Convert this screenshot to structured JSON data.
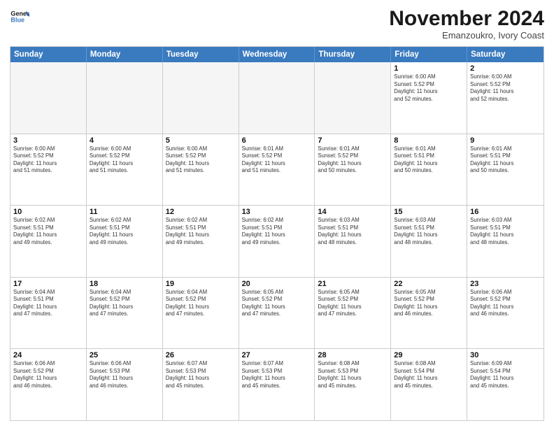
{
  "logo": {
    "line1": "General",
    "line2": "Blue"
  },
  "title": "November 2024",
  "location": "Emanzoukro, Ivory Coast",
  "header": {
    "days": [
      "Sunday",
      "Monday",
      "Tuesday",
      "Wednesday",
      "Thursday",
      "Friday",
      "Saturday"
    ]
  },
  "weeks": [
    [
      {
        "day": "",
        "info": ""
      },
      {
        "day": "",
        "info": ""
      },
      {
        "day": "",
        "info": ""
      },
      {
        "day": "",
        "info": ""
      },
      {
        "day": "",
        "info": ""
      },
      {
        "day": "1",
        "info": "Sunrise: 6:00 AM\nSunset: 5:52 PM\nDaylight: 11 hours\nand 52 minutes."
      },
      {
        "day": "2",
        "info": "Sunrise: 6:00 AM\nSunset: 5:52 PM\nDaylight: 11 hours\nand 52 minutes."
      }
    ],
    [
      {
        "day": "3",
        "info": "Sunrise: 6:00 AM\nSunset: 5:52 PM\nDaylight: 11 hours\nand 51 minutes."
      },
      {
        "day": "4",
        "info": "Sunrise: 6:00 AM\nSunset: 5:52 PM\nDaylight: 11 hours\nand 51 minutes."
      },
      {
        "day": "5",
        "info": "Sunrise: 6:00 AM\nSunset: 5:52 PM\nDaylight: 11 hours\nand 51 minutes."
      },
      {
        "day": "6",
        "info": "Sunrise: 6:01 AM\nSunset: 5:52 PM\nDaylight: 11 hours\nand 51 minutes."
      },
      {
        "day": "7",
        "info": "Sunrise: 6:01 AM\nSunset: 5:52 PM\nDaylight: 11 hours\nand 50 minutes."
      },
      {
        "day": "8",
        "info": "Sunrise: 6:01 AM\nSunset: 5:51 PM\nDaylight: 11 hours\nand 50 minutes."
      },
      {
        "day": "9",
        "info": "Sunrise: 6:01 AM\nSunset: 5:51 PM\nDaylight: 11 hours\nand 50 minutes."
      }
    ],
    [
      {
        "day": "10",
        "info": "Sunrise: 6:02 AM\nSunset: 5:51 PM\nDaylight: 11 hours\nand 49 minutes."
      },
      {
        "day": "11",
        "info": "Sunrise: 6:02 AM\nSunset: 5:51 PM\nDaylight: 11 hours\nand 49 minutes."
      },
      {
        "day": "12",
        "info": "Sunrise: 6:02 AM\nSunset: 5:51 PM\nDaylight: 11 hours\nand 49 minutes."
      },
      {
        "day": "13",
        "info": "Sunrise: 6:02 AM\nSunset: 5:51 PM\nDaylight: 11 hours\nand 49 minutes."
      },
      {
        "day": "14",
        "info": "Sunrise: 6:03 AM\nSunset: 5:51 PM\nDaylight: 11 hours\nand 48 minutes."
      },
      {
        "day": "15",
        "info": "Sunrise: 6:03 AM\nSunset: 5:51 PM\nDaylight: 11 hours\nand 48 minutes."
      },
      {
        "day": "16",
        "info": "Sunrise: 6:03 AM\nSunset: 5:51 PM\nDaylight: 11 hours\nand 48 minutes."
      }
    ],
    [
      {
        "day": "17",
        "info": "Sunrise: 6:04 AM\nSunset: 5:51 PM\nDaylight: 11 hours\nand 47 minutes."
      },
      {
        "day": "18",
        "info": "Sunrise: 6:04 AM\nSunset: 5:52 PM\nDaylight: 11 hours\nand 47 minutes."
      },
      {
        "day": "19",
        "info": "Sunrise: 6:04 AM\nSunset: 5:52 PM\nDaylight: 11 hours\nand 47 minutes."
      },
      {
        "day": "20",
        "info": "Sunrise: 6:05 AM\nSunset: 5:52 PM\nDaylight: 11 hours\nand 47 minutes."
      },
      {
        "day": "21",
        "info": "Sunrise: 6:05 AM\nSunset: 5:52 PM\nDaylight: 11 hours\nand 47 minutes."
      },
      {
        "day": "22",
        "info": "Sunrise: 6:05 AM\nSunset: 5:52 PM\nDaylight: 11 hours\nand 46 minutes."
      },
      {
        "day": "23",
        "info": "Sunrise: 6:06 AM\nSunset: 5:52 PM\nDaylight: 11 hours\nand 46 minutes."
      }
    ],
    [
      {
        "day": "24",
        "info": "Sunrise: 6:06 AM\nSunset: 5:52 PM\nDaylight: 11 hours\nand 46 minutes."
      },
      {
        "day": "25",
        "info": "Sunrise: 6:06 AM\nSunset: 5:53 PM\nDaylight: 11 hours\nand 46 minutes."
      },
      {
        "day": "26",
        "info": "Sunrise: 6:07 AM\nSunset: 5:53 PM\nDaylight: 11 hours\nand 45 minutes."
      },
      {
        "day": "27",
        "info": "Sunrise: 6:07 AM\nSunset: 5:53 PM\nDaylight: 11 hours\nand 45 minutes."
      },
      {
        "day": "28",
        "info": "Sunrise: 6:08 AM\nSunset: 5:53 PM\nDaylight: 11 hours\nand 45 minutes."
      },
      {
        "day": "29",
        "info": "Sunrise: 6:08 AM\nSunset: 5:54 PM\nDaylight: 11 hours\nand 45 minutes."
      },
      {
        "day": "30",
        "info": "Sunrise: 6:09 AM\nSunset: 5:54 PM\nDaylight: 11 hours\nand 45 minutes."
      }
    ]
  ]
}
